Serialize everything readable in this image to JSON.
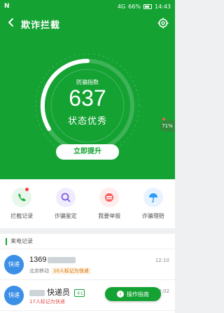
{
  "status_bar": {
    "icons_left": "N",
    "clock_label": "14:43",
    "signal_label": "4G",
    "battery_label": "66%"
  },
  "header": {
    "title": "欺诈拦截",
    "back_icon": "back-arrow-icon",
    "settings_icon": "gear-icon"
  },
  "score": {
    "label": "防骗指数",
    "value": "637",
    "status": "状态优秀",
    "side_percent": "71%"
  },
  "cta": {
    "label": "立即提升"
  },
  "quick_actions": [
    {
      "label": "拦截记录",
      "icon": "phone-intercept-icon",
      "color": "#27b24a"
    },
    {
      "label": "诈骗鉴定",
      "icon": "search-icon",
      "color": "#7b5de8"
    },
    {
      "label": "我要举报",
      "icon": "report-icon",
      "color": "#ff5a5a"
    },
    {
      "label": "诈骗理赔",
      "icon": "umbrella-icon",
      "color": "#2a9cff"
    }
  ],
  "calls": {
    "title": "来电记录",
    "items": [
      {
        "avatar_text": "快递",
        "number_prefix": "1369",
        "location": "北京移动",
        "tag": "10人标记为快递",
        "time": "12:10"
      },
      {
        "avatar_text": "快递",
        "number_suffix": "快递员",
        "badge": "十1",
        "tag": "17人标记为快递",
        "time": "12:02"
      }
    ]
  },
  "floating_guide": {
    "label": "操作指南"
  }
}
